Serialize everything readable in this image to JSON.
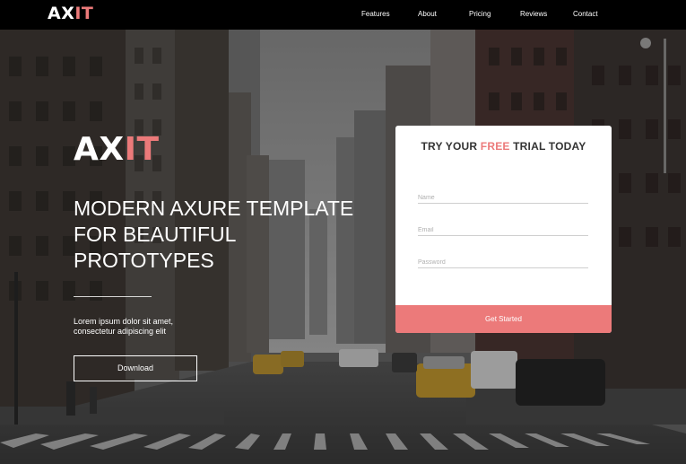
{
  "nav": {
    "logo_white": "AX",
    "logo_accent": "IT",
    "links": [
      "Features",
      "About",
      "Pricing",
      "Reviews",
      "Contact"
    ]
  },
  "hero": {
    "logo_white": "AX",
    "logo_accent": "IT",
    "headline_lines": [
      "MODERN AXURE TEMPLATE",
      "FOR BEAUTIFUL",
      "PROTOTYPES"
    ],
    "subtext_lines": [
      "Lorem ipsum dolor sit amet,",
      "consectetur adipiscing elit"
    ],
    "download_label": "Download"
  },
  "trial": {
    "title_before": "TRY YOUR ",
    "title_accent": "FREE",
    "title_after": " TRIAL TODAY",
    "fields": {
      "name_placeholder": "Name",
      "email_placeholder": "Email",
      "password_placeholder": "Password"
    },
    "submit_label": "Get Started"
  },
  "colors": {
    "accent": "#ec7a7a",
    "nav_bg": "#000000",
    "card_bg": "#ffffff",
    "title_text": "#333333"
  }
}
